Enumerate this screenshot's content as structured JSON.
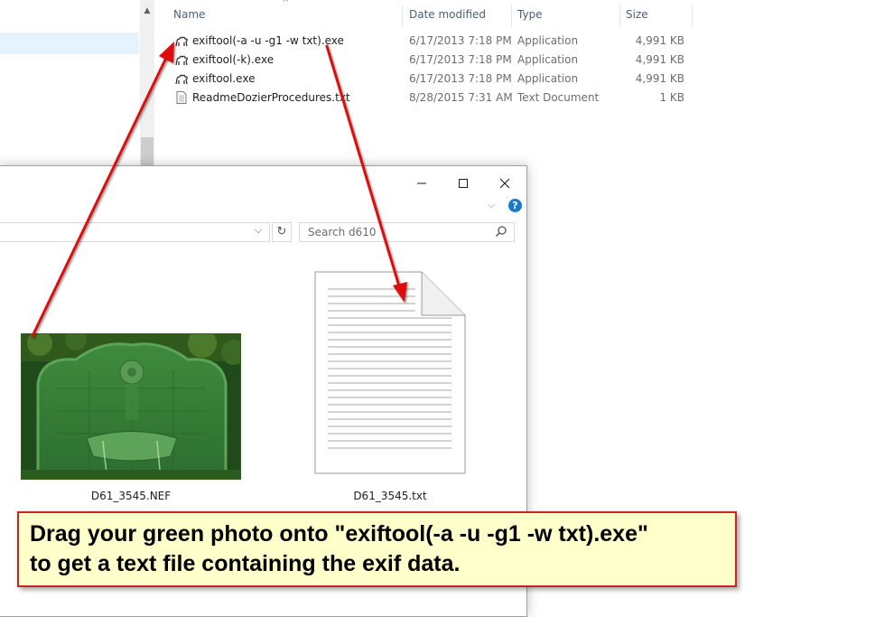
{
  "back_window": {
    "columns": {
      "name": "Name",
      "date_modified": "Date modified",
      "type": "Type",
      "size": "Size"
    },
    "files": [
      {
        "name": "exiftool(-a -u -g1 -w txt).exe",
        "date": "6/17/2013 7:18 PM",
        "type": "Application",
        "size": "4,991 KB",
        "icon": "camel-app-icon"
      },
      {
        "name": "exiftool(-k).exe",
        "date": "6/17/2013 7:18 PM",
        "type": "Application",
        "size": "4,991 KB",
        "icon": "camel-app-icon"
      },
      {
        "name": "exiftool.exe",
        "date": "6/17/2013 7:18 PM",
        "type": "Application",
        "size": "4,991 KB",
        "icon": "camel-app-icon"
      },
      {
        "name": "ReadmeDozierProcedures.txt",
        "date": "8/28/2015 7:31 AM",
        "type": "Text Document",
        "size": "1 KB",
        "icon": "text-document-icon"
      }
    ]
  },
  "front_window": {
    "search": {
      "placeholder": "Search d610"
    },
    "items": [
      {
        "name": "D61_3545.NEF",
        "icon": "photo-thumbnail"
      },
      {
        "name": "D61_3545.txt",
        "icon": "text-document-icon"
      }
    ]
  },
  "callout": {
    "line1": "Drag your green photo onto \"exiftool(-a -u -g1 -w txt).exe\"",
    "line2": "to get a text file containing the exif data."
  },
  "colors": {
    "arrow": "#dd1111",
    "callout_bg": "#ffffcc",
    "callout_border": "#cc2222",
    "header_text": "#4c607a"
  }
}
